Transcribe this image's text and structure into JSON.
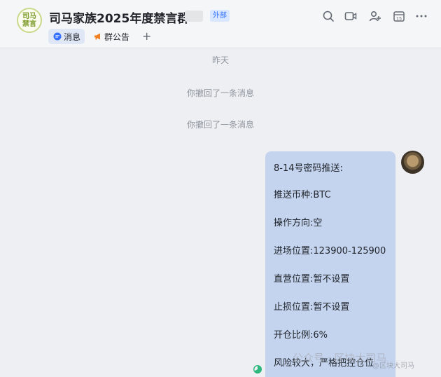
{
  "header": {
    "avatar_text_line1": "司马",
    "avatar_text_line2": "禁言",
    "title": "司马家族2025年度禁言群",
    "tag": "外部",
    "icons": [
      "search-icon",
      "video-icon",
      "add-member-icon",
      "calendar-icon",
      "more-icon"
    ],
    "calendar_day": "15"
  },
  "tabs": [
    {
      "label": "消息",
      "icon": "message-icon",
      "active": true
    },
    {
      "label": "群公告",
      "icon": "megaphone-icon",
      "active": false
    }
  ],
  "add_tab_label": "+",
  "messages": {
    "date_separator": "昨天",
    "recall_1": "你撤回了一条消息",
    "recall_2": "你撤回了一条消息",
    "bubble_lines": [
      "8-14号密码推送:",
      "推送币种:BTC",
      "操作方向:空",
      "进场位置:123900-125900",
      "直营位置:暂不设置",
      "止损位置:暂不设置",
      "开仓比例:6%",
      "风险较大，严格把控仓位"
    ]
  },
  "watermark": {
    "text": "公众号 · 区块大司马",
    "small": "@区块大司马"
  },
  "colors": {
    "accent": "#3370ff",
    "bubble": "#c4d4ef",
    "background": "#eeeff2",
    "read_status": "#2db87d"
  }
}
